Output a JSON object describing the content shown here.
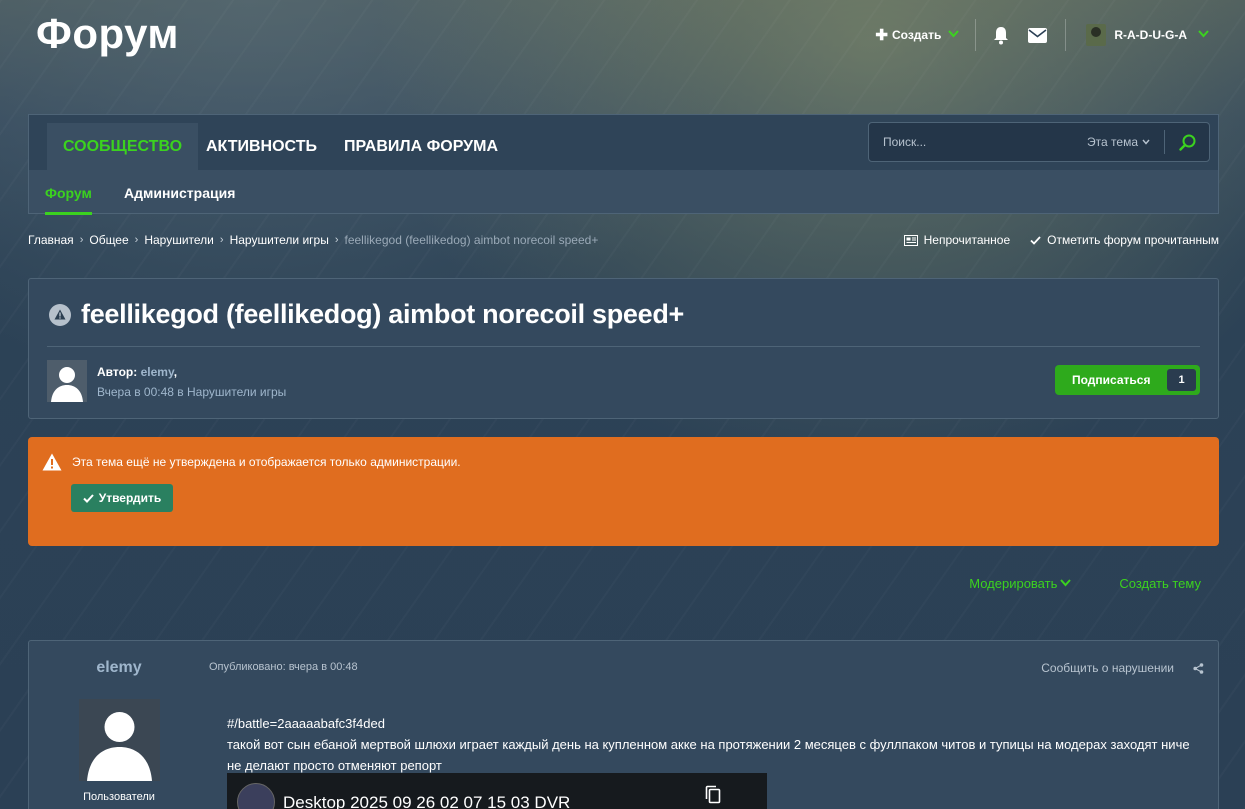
{
  "header": {
    "site_title": "Форум",
    "create_label": "Создать",
    "username": "R-A-D-U-G-A",
    "icons": [
      "plus-icon",
      "bell-icon",
      "envelope-icon",
      "chevron-down-icon"
    ]
  },
  "nav": {
    "tabs": [
      {
        "label": "СООБЩЕСТВО",
        "active": true
      },
      {
        "label": "АКТИВНОСТЬ",
        "active": false
      },
      {
        "label": "ПРАВИЛА ФОРУМА",
        "active": false
      }
    ],
    "subtabs": [
      {
        "label": "Форум",
        "active": true
      },
      {
        "label": "Администрация",
        "active": false
      }
    ],
    "search": {
      "placeholder": "Поиск...",
      "scope": "Эта тема"
    }
  },
  "breadcrumb": {
    "items": [
      "Главная",
      "Общее",
      "Нарушители",
      "Нарушители игры"
    ],
    "current": "feellikegod (feellikedog) aimbot norecoil speed+"
  },
  "crumb_actions": {
    "unread": "Непрочитанное",
    "mark_read": "Отметить форум прочитанным"
  },
  "topic": {
    "title": "feellikegod (feellikedog) aimbot norecoil speed+",
    "author_label": "Автор:",
    "author_name": "elemy",
    "author_suffix": ",",
    "posted": "Вчера в 00:48 в Нарушители игры",
    "follow_label": "Подписаться",
    "follow_count": "1"
  },
  "warning": {
    "text": "Эта тема ещё не утверждена и отображается только администрации.",
    "approve_label": "Утвердить"
  },
  "moderation": {
    "moderate_label": "Модерировать",
    "create_topic_label": "Создать тему"
  },
  "post": {
    "author": "elemy",
    "group": "Пользователи",
    "date": "Опубликовано: вчера в 00:48",
    "report": "Сообщить о нарушении",
    "body_line1": "#/battle=2aaaaabafc3f4ded",
    "body_line2": "такой вот сын ебаной мертвой шлюхи играет каждый день на купленном акке на протяжении 2 месяцев с фуллпаком читов и тупицы на модерах заходят ниче не делают просто отменяют репорт",
    "video_title": "Desktop 2025 09 26 02 07 15 03 DVR"
  },
  "colors": {
    "accent": "#3bd21f",
    "warning": "#e06d1f",
    "approve": "#2a8060",
    "panel": "#34495e"
  }
}
